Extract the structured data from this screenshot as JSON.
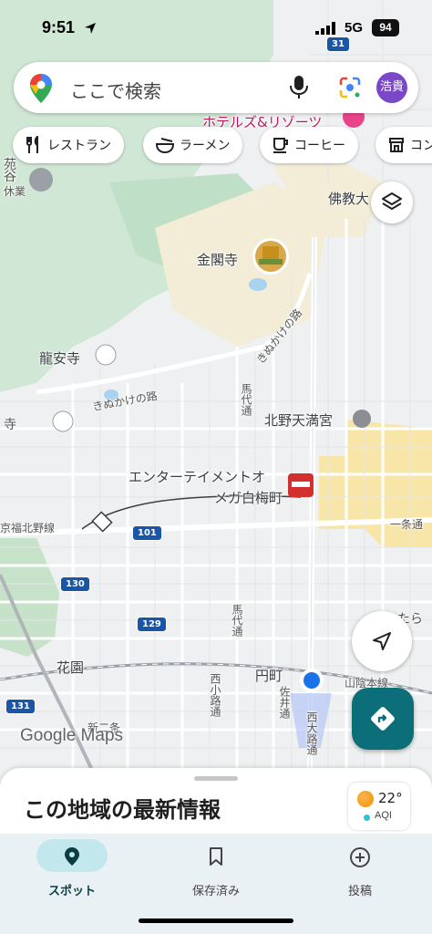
{
  "status_bar": {
    "time": "9:51",
    "network": "5G",
    "battery": "94"
  },
  "search": {
    "placeholder": "ここで検索",
    "avatar_text": "浩貴"
  },
  "chips": [
    {
      "label": "レストラン",
      "icon": "fork-knife-icon"
    },
    {
      "label": "ラーメン",
      "icon": "ramen-bowl-icon"
    },
    {
      "label": "コーヒー",
      "icon": "coffee-cup-icon"
    },
    {
      "label": "コン",
      "icon": "convenience-store-icon"
    }
  ],
  "map_labels": {
    "kinkakuji": "金閣寺",
    "ryoanji": "龍安寺",
    "kitano": "北野天満宮",
    "entertainment": "エンターテイメントオ",
    "entertainment2": "メガ白梅町",
    "hanazono": "花園",
    "emmachi": "円町",
    "kinukake1": "きぬかけの路",
    "kinukake2": "きぬかけの路",
    "bukkyo": "佛教大",
    "ichijo": "一条通",
    "kyofuku": "京福北野線",
    "nishikoji": "西小路通",
    "saidoori": "佐井通",
    "nishioji": "西大路通",
    "badai": "馬代通",
    "baku": "馬代通",
    "hotel": "ホテルズ&リゾーツ",
    "sanin": "山陰本線",
    "ji_left": "寺",
    "en": "苑",
    "tani": "谷",
    "kyuugyou": "休業",
    "takeya": "たら",
    "nishi_shijo": "新二条",
    "road_101": "101",
    "road_130": "130",
    "road_129": "129",
    "road_131": "131",
    "road_31": "31"
  },
  "google_logo": "Google Maps",
  "sheet": {
    "title": "この地域の最新情報"
  },
  "weather": {
    "temp": "22°",
    "aqi_label": "AQI"
  },
  "nav": [
    {
      "label": "スポット",
      "icon": "location-pin-icon",
      "active": true
    },
    {
      "label": "保存済み",
      "icon": "bookmark-icon",
      "active": false
    },
    {
      "label": "投稿",
      "icon": "add-circle-icon",
      "active": false
    }
  ],
  "colors": {
    "accent": "#0b6e79",
    "avatar": "#7b47c9",
    "location_dot": "#1a73e8"
  }
}
